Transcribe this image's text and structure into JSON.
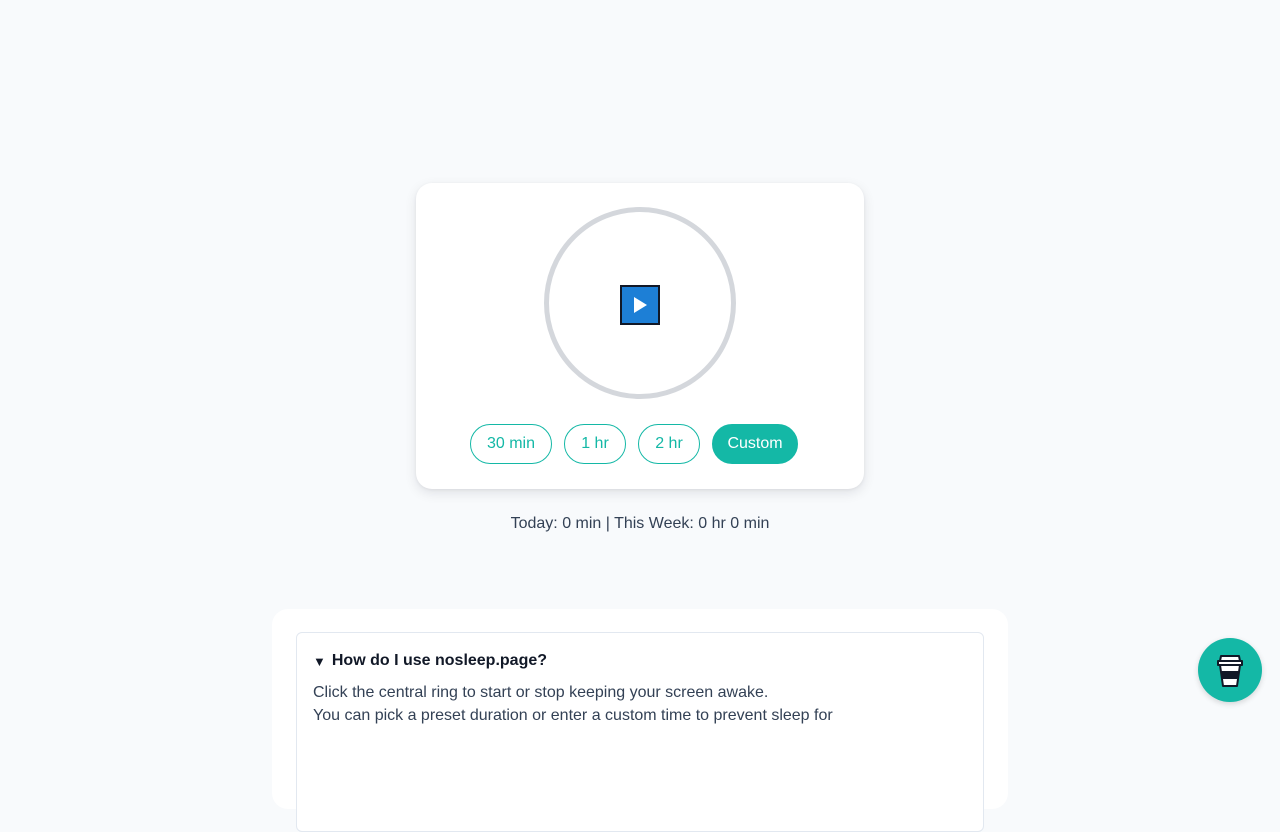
{
  "timer": {
    "presets": [
      {
        "label": "30 min"
      },
      {
        "label": "1 hr"
      },
      {
        "label": "2 hr"
      }
    ],
    "custom_label": "Custom"
  },
  "stats": {
    "text": "Today: 0 min | This Week: 0 hr 0 min"
  },
  "faq": {
    "question": "How do I use nosleep.page?",
    "answer_lines": [
      "Click the central ring to start or stop keeping your screen awake.",
      "You can pick a preset duration or enter a custom time to prevent sleep for"
    ]
  },
  "icons": {
    "play": "play-icon",
    "coffee": "coffee-cup-icon",
    "caret": "caret-down-icon"
  },
  "colors": {
    "accent": "#14b8a6",
    "play": "#1d7fd6",
    "ring": "#d4d7dc",
    "background": "#f8fafc"
  }
}
